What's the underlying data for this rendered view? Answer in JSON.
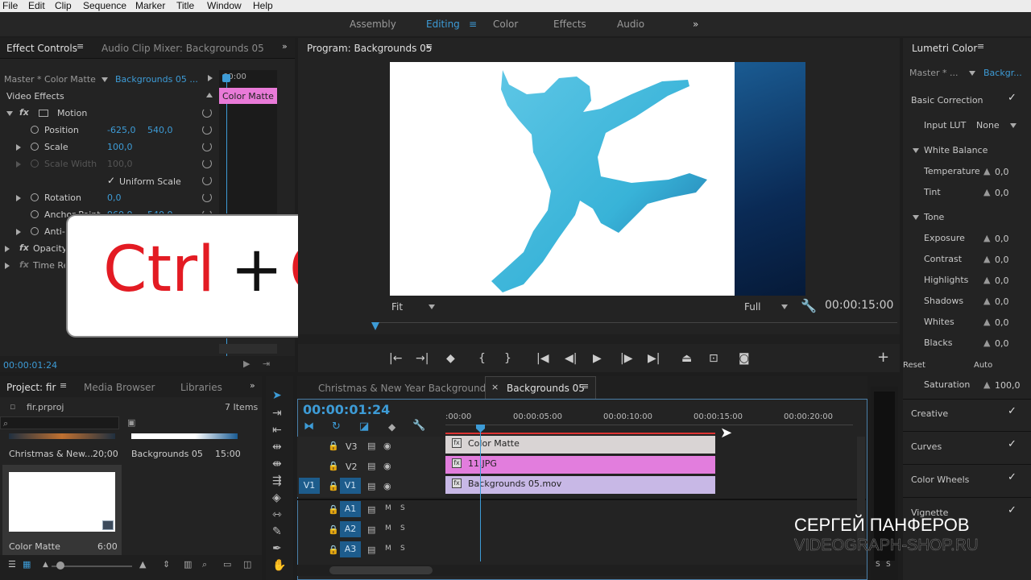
{
  "menu": [
    "File",
    "Edit",
    "Clip",
    "Sequence",
    "Marker",
    "Title",
    "Window",
    "Help"
  ],
  "workspaces": [
    "Assembly",
    "Editing",
    "Color",
    "Effects",
    "Audio"
  ],
  "effect_controls": {
    "tab": "Effect Controls",
    "tab2": "Audio Clip Mixer: Backgrounds 05",
    "source": "Master * Color Matte",
    "target": "Backgrounds 05 ...",
    "ruler_time": "00:00",
    "clip_label": "Color Matte",
    "section": "Video Effects",
    "motion": "Motion",
    "position_label": "Position",
    "position_x": "-625,0",
    "position_y": "540,0",
    "scale_label": "Scale",
    "scale_val": "100,0",
    "scale_width_label": "Scale Width",
    "scale_width_val": "100,0",
    "uniform_scale": "Uniform Scale",
    "rotation_label": "Rotation",
    "rotation_val": "0,0",
    "anchor_label": "Anchor Point",
    "anchor_x": "960,0",
    "anchor_y": "540,0",
    "antiflicker_label": "Anti-flicker Filter",
    "opacity_label": "Opacity",
    "timeremap_label": "Time Remapping",
    "timecode": "00:00:01:24"
  },
  "overlay": {
    "ctrl": "Ctrl",
    "plus": "+",
    "key": "C"
  },
  "program": {
    "title": "Program: Backgrounds 05",
    "fit": "Fit",
    "quality": "Full",
    "duration": "00:00:15:00"
  },
  "lumetri": {
    "title": "Lumetri Color",
    "source": "Master * ...",
    "target": "Backgr...",
    "basic_correction": "Basic Correction",
    "input_lut_label": "Input LUT",
    "input_lut_val": "None",
    "white_balance": "White Balance",
    "temperature": "Temperature",
    "temperature_val": "0,0",
    "tint": "Tint",
    "tint_val": "0,0",
    "tone": "Tone",
    "exposure": "Exposure",
    "exposure_val": "0,0",
    "contrast": "Contrast",
    "contrast_val": "0,0",
    "highlights": "Highlights",
    "highlights_val": "0,0",
    "shadows": "Shadows",
    "shadows_val": "0,0",
    "whites": "Whites",
    "whites_val": "0,0",
    "blacks": "Blacks",
    "blacks_val": "0,0",
    "reset": "Reset",
    "auto": "Auto",
    "saturation": "Saturation",
    "saturation_val": "100,0",
    "creative": "Creative",
    "curves": "Curves",
    "color_wheels": "Color Wheels",
    "vignette": "Vignette"
  },
  "project": {
    "tab": "Project: fir",
    "tab2": "Media Browser",
    "tab3": "Libraries",
    "file": "fir.prproj",
    "items": "7 Items",
    "bins": [
      {
        "name": "Christmas & New...",
        "dur": "20;00"
      },
      {
        "name": "Backgrounds 05",
        "dur": "15:00"
      },
      {
        "name": "Color Matte",
        "dur": "6:00"
      }
    ]
  },
  "timeline": {
    "tab1": "Christmas & New Year Background",
    "tab2": "Backgrounds 05",
    "timecode": "00:00:01:24",
    "ruler": [
      ":00:00",
      "00:00:05:00",
      "00:00:10:00",
      "00:00:15:00",
      "00:00:20:00"
    ],
    "tracks": [
      "V3",
      "V2",
      "V1",
      "A1",
      "A2",
      "A3"
    ],
    "v1_source": "V1",
    "clips": {
      "v3": "Color Matte",
      "v2": "11.JPG",
      "v1": "Backgrounds 05.mov"
    },
    "m": "M",
    "s": "S"
  },
  "meter": {
    "s": "S"
  },
  "watermark": {
    "name": "СЕРГЕЙ ПАНФЕРОВ",
    "site": "VIDEOGRAPH-SHOP.RU"
  },
  "colors": {
    "accent": "#3d9bd6",
    "color_matte_clip": "#d9d4d4",
    "jpg_clip": "#e27ddd",
    "mov_clip": "#c8b8e6",
    "ec_clip": "#e97ad8"
  }
}
